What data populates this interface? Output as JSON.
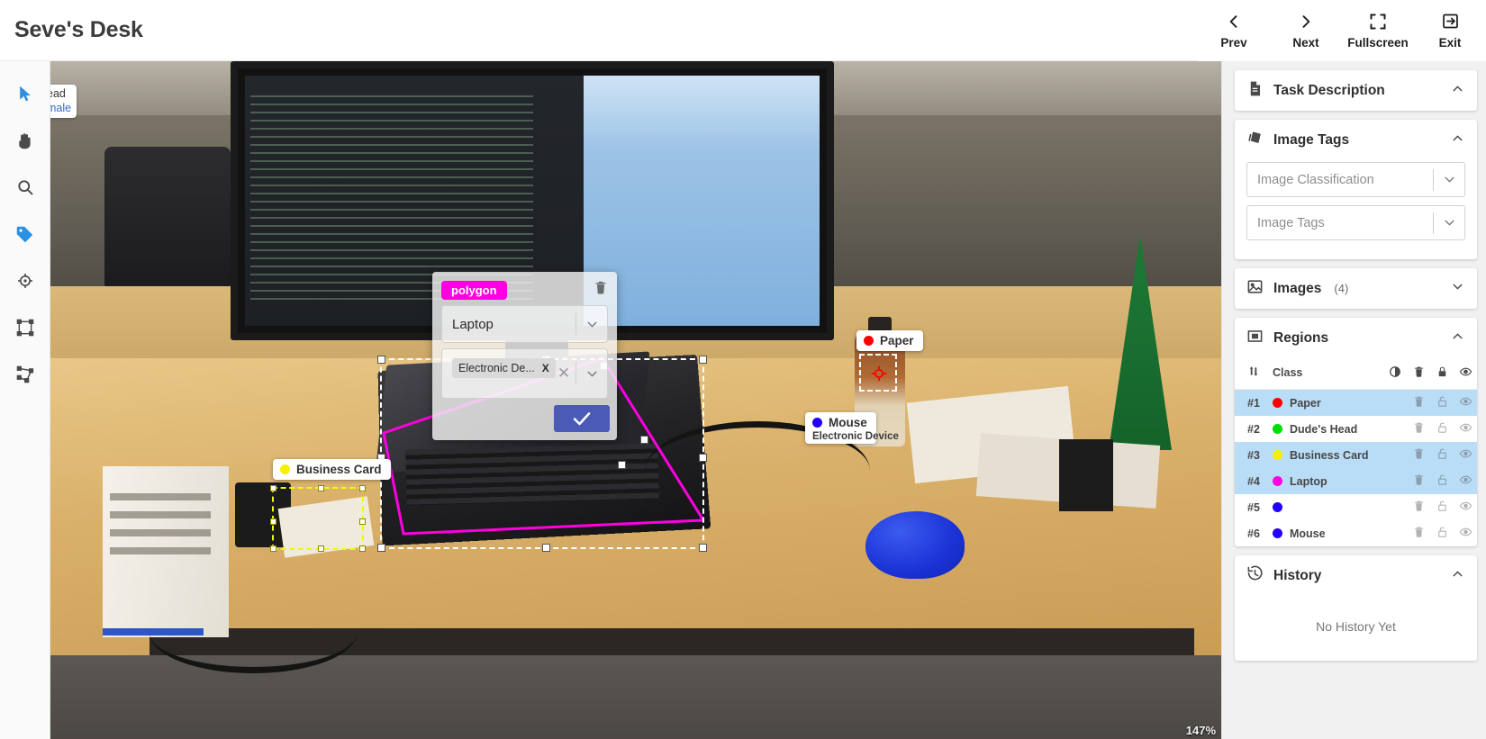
{
  "header": {
    "title": "Seve's Desk",
    "actions": [
      {
        "label": "Prev",
        "icon": "chevron-left-icon"
      },
      {
        "label": "Next",
        "icon": "chevron-right-icon"
      },
      {
        "label": "Fullscreen",
        "icon": "fullscreen-icon"
      },
      {
        "label": "Exit",
        "icon": "exit-icon"
      }
    ]
  },
  "toolbar": {
    "tools": [
      {
        "name": "select-tool",
        "icon": "cursor-icon",
        "active": true
      },
      {
        "name": "pan-tool",
        "icon": "hand-icon",
        "active": false
      },
      {
        "name": "zoom-tool",
        "icon": "magnifier-icon",
        "active": false
      },
      {
        "name": "tag-tool",
        "icon": "tag-icon",
        "active": true
      },
      {
        "name": "point-tool",
        "icon": "crosshair-icon",
        "active": false
      },
      {
        "name": "box-tool",
        "icon": "bounding-box-icon",
        "active": false
      },
      {
        "name": "polygon-tool",
        "icon": "polygon-icon",
        "active": false
      }
    ]
  },
  "canvas": {
    "zoom_level": "147%",
    "cut_label": {
      "line1": "ead",
      "line2": "male"
    },
    "labels": [
      {
        "text": "Paper",
        "color": "#ff0000"
      },
      {
        "text": "Mouse",
        "color": "#2200ff",
        "sub": "Electronic Device"
      },
      {
        "text": "Business Card",
        "color": "#eaff00"
      }
    ]
  },
  "region_editor": {
    "type_chip": "polygon",
    "chip_color": "#ff00e0",
    "class_value": "Laptop",
    "tags": [
      {
        "label": "Electronic De...",
        "remove": "X"
      }
    ],
    "confirm_icon": "check-icon",
    "delete_icon": "trash-icon"
  },
  "sidebar": {
    "task_description": {
      "title": "Task Description",
      "icon": "document-icon",
      "expanded": true
    },
    "image_tags": {
      "title": "Image Tags",
      "icon": "tags-icon",
      "expanded": true,
      "fields": [
        {
          "name": "image-classification",
          "placeholder": "Image Classification",
          "value": ""
        },
        {
          "name": "image-tags",
          "placeholder": "Image Tags",
          "value": ""
        }
      ]
    },
    "images": {
      "title": "Images",
      "count": "(4)",
      "icon": "images-icon",
      "expanded": false
    },
    "regions": {
      "title": "Regions",
      "icon": "region-icon",
      "expanded": true,
      "columns": [
        {
          "key": "sort",
          "label": "",
          "icon": "sort-icon"
        },
        {
          "key": "class",
          "label": "Class"
        },
        {
          "key": "opacity",
          "label": "",
          "icon": "contrast-icon"
        },
        {
          "key": "delete",
          "label": "",
          "icon": "trash-icon"
        },
        {
          "key": "lock",
          "label": "",
          "icon": "lock-icon"
        },
        {
          "key": "visible",
          "label": "",
          "icon": "eye-icon"
        }
      ],
      "rows": [
        {
          "index": "#1",
          "class": "Paper",
          "color": "#ff0000",
          "selected": true
        },
        {
          "index": "#2",
          "class": "Dude's Head",
          "color": "#00dd00",
          "selected": false
        },
        {
          "index": "#3",
          "class": "Business Card",
          "color": "#f5f000",
          "selected": true
        },
        {
          "index": "#4",
          "class": "Laptop",
          "color": "#ff00e0",
          "selected": true
        },
        {
          "index": "#5",
          "class": "",
          "color": "#2200ff",
          "selected": false
        },
        {
          "index": "#6",
          "class": "Mouse",
          "color": "#2200ff",
          "selected": false
        }
      ]
    },
    "history": {
      "title": "History",
      "icon": "history-icon",
      "expanded": true,
      "empty_text": "No History Yet"
    }
  }
}
